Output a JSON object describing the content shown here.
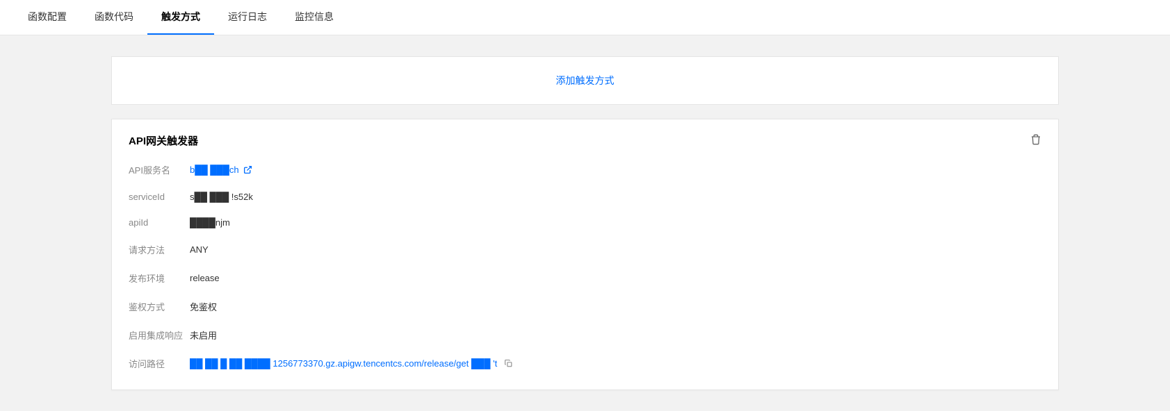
{
  "tabs": {
    "config": "函数配置",
    "code": "函数代码",
    "trigger": "触发方式",
    "logs": "运行日志",
    "monitor": "监控信息"
  },
  "add_trigger": "添加触发方式",
  "trigger": {
    "title": "API网关触发器",
    "fields": {
      "api_service_name": {
        "label": "API服务名",
        "value": "b██ ███ch"
      },
      "service_id": {
        "label": "serviceId",
        "value": "s██ ███ !s52k"
      },
      "api_id": {
        "label": "apiId",
        "value": "████njm"
      },
      "request_method": {
        "label": "请求方法",
        "value": "ANY"
      },
      "release_env": {
        "label": "发布环境",
        "value": "release"
      },
      "auth_method": {
        "label": "鉴权方式",
        "value": "免鉴权"
      },
      "integration_response": {
        "label": "启用集成响应",
        "value": "未启用"
      },
      "access_path": {
        "label": "访问路径",
        "value": "██ ██ █ ██ ████ 1256773370.gz.apigw.tencentcs.com/release/get ███ 't"
      }
    }
  }
}
